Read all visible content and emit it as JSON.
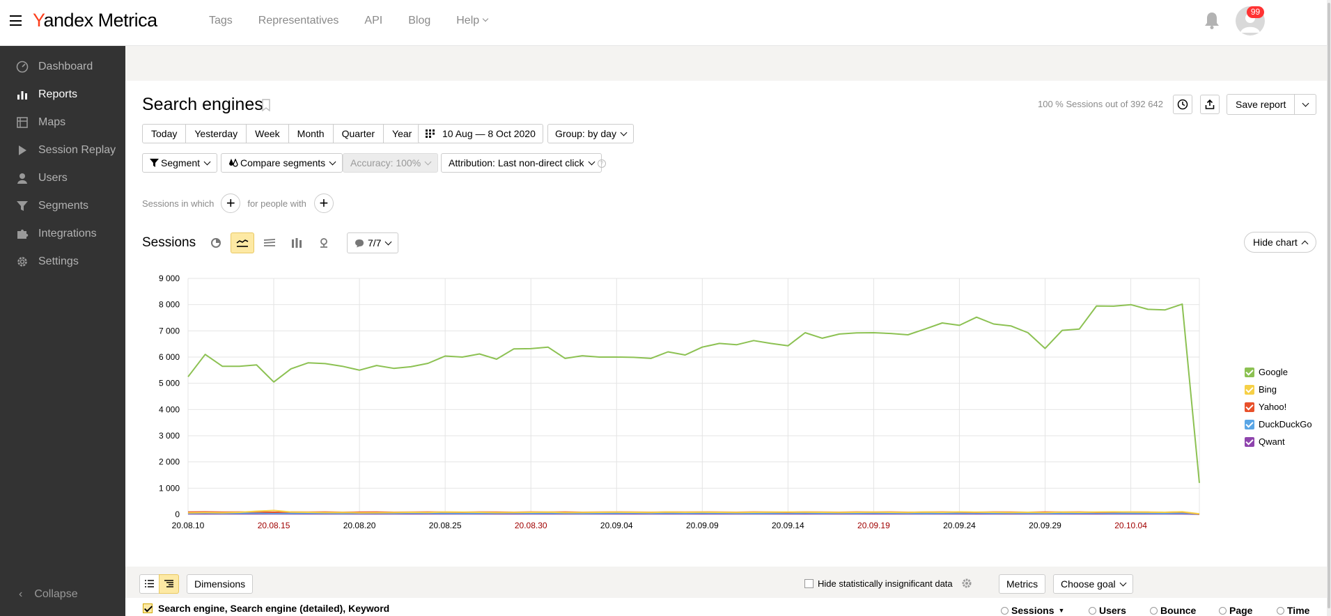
{
  "app": {
    "logo_y": "Y",
    "logo_rest": "andex Metrica",
    "notifications_count": "99"
  },
  "topnav": [
    {
      "label": "Tags"
    },
    {
      "label": "Representatives"
    },
    {
      "label": "API"
    },
    {
      "label": "Blog"
    },
    {
      "label": "Help"
    }
  ],
  "sidebar": {
    "items": [
      {
        "label": "Dashboard",
        "icon": "gauge-icon"
      },
      {
        "label": "Reports",
        "icon": "bar-chart-icon",
        "active": true
      },
      {
        "label": "Maps",
        "icon": "map-icon"
      },
      {
        "label": "Session Replay",
        "icon": "play-icon"
      },
      {
        "label": "Users",
        "icon": "user-icon"
      },
      {
        "label": "Segments",
        "icon": "funnel-icon"
      },
      {
        "label": "Integrations",
        "icon": "puzzle-icon"
      },
      {
        "label": "Settings",
        "icon": "gear-icon"
      }
    ],
    "collapse": "Collapse"
  },
  "report": {
    "title": "Search engines",
    "sessions_info": "100 % Sessions out of 392 642",
    "save_report": "Save report",
    "periods": [
      "Today",
      "Yesterday",
      "Week",
      "Month",
      "Quarter",
      "Year"
    ],
    "date_range": "10 Aug — 8 Oct 2020",
    "group": "Group: by day",
    "segment": "Segment",
    "compare": "Compare segments",
    "accuracy": "Accuracy: 100%",
    "attribution": "Attribution: Last non-direct click",
    "sessions_in_which": "Sessions in which",
    "for_people_with": "for people with",
    "metric_label": "Sessions",
    "annotations": "7/7",
    "hide_chart": "Hide chart"
  },
  "bottom": {
    "dimensions": "Dimensions",
    "hide_insignificant": "Hide statistically insignificant data",
    "metrics": "Metrics",
    "choose_goal": "Choose goal",
    "dimension_header": "Search engine, Search engine (detailed), Keyword",
    "columns": [
      "Sessions",
      "Users",
      "Bounce",
      "Page",
      "Time"
    ]
  },
  "colors": {
    "google": "#8cc152",
    "bing": "#f6d046",
    "yahoo": "#e8502a",
    "duckduckgo": "#5aa6e6",
    "qwant": "#8e44ad",
    "weekend_label": "#a00000"
  },
  "chart_data": {
    "type": "line",
    "ylim": [
      0,
      9000
    ],
    "yticks": [
      "0",
      "1 000",
      "2 000",
      "3 000",
      "4 000",
      "5 000",
      "6 000",
      "7 000",
      "8 000",
      "9 000"
    ],
    "xticks": [
      {
        "label": "20.08.10",
        "index": 0,
        "weekend": false
      },
      {
        "label": "20.08.15",
        "index": 5,
        "weekend": true
      },
      {
        "label": "20.08.20",
        "index": 10,
        "weekend": false
      },
      {
        "label": "20.08.25",
        "index": 15,
        "weekend": false
      },
      {
        "label": "20.08.30",
        "index": 20,
        "weekend": true
      },
      {
        "label": "20.09.04",
        "index": 25,
        "weekend": false
      },
      {
        "label": "20.09.09",
        "index": 30,
        "weekend": false
      },
      {
        "label": "20.09.14",
        "index": 35,
        "weekend": false
      },
      {
        "label": "20.09.19",
        "index": 40,
        "weekend": true
      },
      {
        "label": "20.09.24",
        "index": 45,
        "weekend": false
      },
      {
        "label": "20.09.29",
        "index": 50,
        "weekend": false
      },
      {
        "label": "20.10.04",
        "index": 55,
        "weekend": true
      }
    ],
    "series": [
      {
        "name": "Google",
        "color": "#8cc152",
        "values": [
          5250,
          6100,
          5650,
          5650,
          5700,
          5050,
          5550,
          5780,
          5750,
          5650,
          5500,
          5680,
          5570,
          5630,
          5760,
          6040,
          6000,
          6120,
          5920,
          6310,
          6320,
          6380,
          5950,
          6050,
          6000,
          6000,
          5990,
          5950,
          6200,
          6080,
          6380,
          6520,
          6470,
          6630,
          6520,
          6430,
          6930,
          6720,
          6880,
          6920,
          6930,
          6900,
          6850,
          7070,
          7300,
          7210,
          7520,
          7260,
          7190,
          6930,
          6330,
          7020,
          7070,
          7950,
          7940,
          8000,
          7820,
          7800,
          8020,
          1200
        ]
      },
      {
        "name": "Bing",
        "color": "#f6d046",
        "values": [
          60,
          70,
          65,
          80,
          120,
          150,
          90,
          80,
          70,
          75,
          60,
          65,
          70,
          80,
          75,
          90,
          85,
          80,
          70,
          75,
          80,
          85,
          70,
          75,
          80,
          85,
          80,
          75,
          90,
          80,
          85,
          80,
          75,
          80,
          85,
          90,
          85,
          80,
          75,
          80,
          85,
          80,
          75,
          90,
          80,
          95,
          85,
          80,
          75,
          80,
          70,
          85,
          80,
          90,
          95,
          90,
          85,
          80,
          100,
          20
        ]
      },
      {
        "name": "Yahoo!",
        "color": "#e8502a",
        "values": [
          90,
          95,
          85,
          90,
          95,
          80,
          90,
          85,
          90,
          80,
          85,
          90,
          80,
          85,
          90,
          85,
          80,
          90,
          85,
          80,
          90,
          85,
          90,
          80,
          85,
          90,
          85,
          80,
          90,
          85,
          90,
          85,
          80,
          90,
          85,
          80,
          90,
          85,
          80,
          90,
          85,
          90,
          80,
          85,
          90,
          85,
          80,
          90,
          85,
          80,
          90,
          85,
          90,
          80,
          85,
          90,
          85,
          80,
          90,
          10
        ]
      },
      {
        "name": "DuckDuckGo",
        "color": "#5aa6e6",
        "values": [
          40,
          45,
          40,
          42,
          45,
          38,
          40,
          42,
          40,
          38,
          40,
          42,
          40,
          45,
          42,
          40,
          38,
          40,
          42,
          45,
          40,
          42,
          40,
          38,
          40,
          42,
          45,
          40,
          42,
          40,
          45,
          42,
          40,
          38,
          40,
          42,
          45,
          40,
          42,
          40,
          45,
          42,
          40,
          38,
          40,
          42,
          45,
          40,
          42,
          40,
          38,
          40,
          42,
          45,
          40,
          42,
          40,
          38,
          45,
          5
        ]
      },
      {
        "name": "Qwant",
        "color": "#8e44ad",
        "values": [
          20,
          22,
          20,
          21,
          22,
          19,
          20,
          21,
          20,
          19,
          20,
          21,
          20,
          22,
          21,
          20,
          19,
          20,
          21,
          22,
          20,
          21,
          20,
          19,
          20,
          21,
          22,
          20,
          21,
          20,
          22,
          21,
          20,
          19,
          20,
          21,
          22,
          20,
          21,
          20,
          22,
          21,
          20,
          19,
          20,
          21,
          22,
          20,
          21,
          20,
          19,
          20,
          21,
          22,
          20,
          21,
          20,
          19,
          22,
          2
        ]
      }
    ]
  }
}
